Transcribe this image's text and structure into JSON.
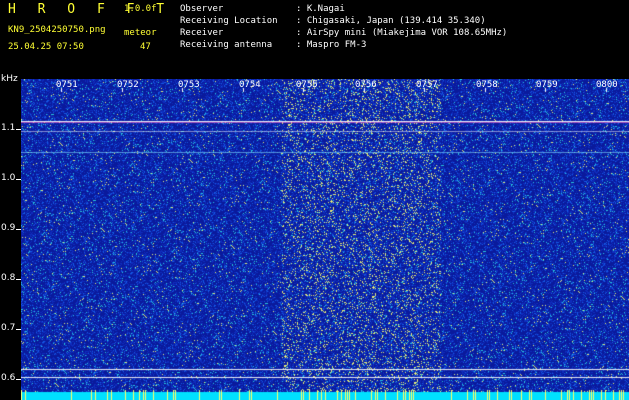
{
  "header": {
    "app_title": "H R O F F T",
    "version": "1.0.0f",
    "filename": "KN9_2504250750.png",
    "datetime": "25.04.25 07:50",
    "meteor_label": "meteor",
    "meteor_count": "47"
  },
  "info": [
    {
      "label": "Observer",
      "value": ": K.Nagai"
    },
    {
      "label": "Receiving Location",
      "value": ": Chigasaki, Japan (139.414 35.340)"
    },
    {
      "label": "Receiver",
      "value": ": AirSpy mini (Miakejima VOR 108.65MHz)"
    },
    {
      "label": "Receiving antenna",
      "value": ": Maspro FM-3"
    }
  ],
  "axis": {
    "unit": "kHz",
    "y_labels": [
      "1.1",
      "1.0",
      "0.9",
      "0.8",
      "0.7",
      "0.6"
    ],
    "time_labels": [
      "0751",
      "0752",
      "0753",
      "0754",
      "0755",
      "0756",
      "0757",
      "0758",
      "0759",
      "0800"
    ]
  },
  "colors": {
    "background": "#000000",
    "spectro_base": "#0a1a9c",
    "text_yellow": "#ffff33",
    "text_white": "#ffffff"
  }
}
